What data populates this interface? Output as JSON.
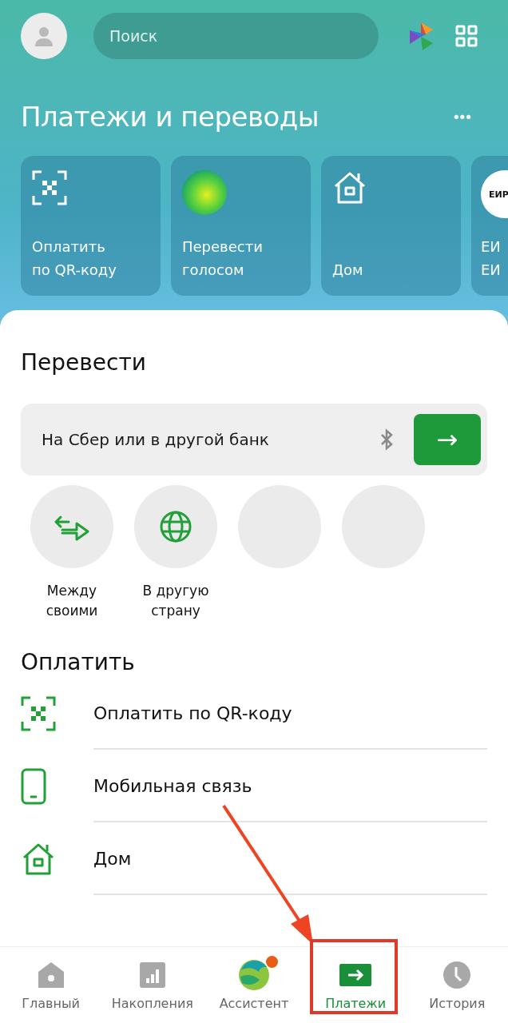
{
  "search": {
    "placeholder": "Поиск"
  },
  "title": "Платежи и переводы",
  "more": "•••",
  "cards": [
    {
      "kind": "qr",
      "lines": [
        "Оплатить",
        "по QR-коду"
      ]
    },
    {
      "kind": "voice",
      "lines": [
        "Перевести",
        "голосом"
      ]
    },
    {
      "kind": "home",
      "lines": [
        "Дом"
      ]
    },
    {
      "kind": "logo",
      "logo": "ЕИР",
      "lines": [
        "ЕИ",
        "ЕИ"
      ]
    }
  ],
  "transfer": {
    "title": "Перевести",
    "field": "На Сбер или в другой банк",
    "go": "→"
  },
  "quick": [
    {
      "kind": "arrows",
      "lines": [
        "Между",
        "своими"
      ]
    },
    {
      "kind": "globe",
      "lines": [
        "В другую",
        "страну"
      ]
    },
    {
      "kind": "blank"
    },
    {
      "kind": "blank"
    }
  ],
  "pay": {
    "title": "Оплатить",
    "items": [
      {
        "kind": "qr",
        "label": "Оплатить по QR-коду"
      },
      {
        "kind": "phone",
        "label": "Мобильная связь"
      },
      {
        "kind": "home",
        "label": "Дом"
      }
    ]
  },
  "nav": [
    {
      "kind": "home",
      "label": "Главный",
      "selected": false,
      "dot": false
    },
    {
      "kind": "chart",
      "label": "Накопления",
      "selected": false,
      "dot": false
    },
    {
      "kind": "assistant",
      "label": "Ассистент",
      "selected": false,
      "dot": true
    },
    {
      "kind": "payments",
      "label": "Платежи",
      "selected": true,
      "dot": false
    },
    {
      "kind": "clock",
      "label": "История",
      "selected": false,
      "dot": false
    }
  ]
}
